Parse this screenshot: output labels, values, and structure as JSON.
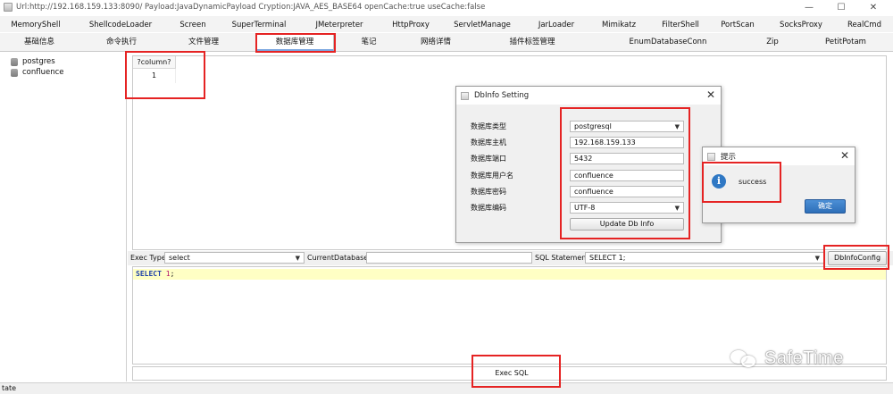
{
  "window": {
    "title": "Url:http://192.168.159.133:8090/ Payload:JavaDynamicPayload Cryption:JAVA_AES_BASE64 openCache:true useCache:false",
    "minimize": "—",
    "maximize": "☐",
    "close": "✕"
  },
  "plugin_tabs": [
    "MemoryShell",
    "ShellcodeLoader",
    "Screen",
    "SuperTerminal",
    "JMeterpreter",
    "HttpProxy",
    "ServletManage",
    "JarLoader",
    "Mimikatz",
    "FilterShell",
    "PortScan",
    "SocksProxy",
    "RealCmd"
  ],
  "main_tabs": [
    "基础信息",
    "命令执行",
    "文件管理",
    "数据库管理",
    "笔记",
    "网络详情",
    "插件标签管理",
    "EnumDatabaseConn",
    "Zip",
    "PetitPotam"
  ],
  "active_main_tab": "数据库管理",
  "tree": {
    "items": [
      "postgres",
      "confluence"
    ]
  },
  "result": {
    "column_header": "?column?",
    "cell_value": "1"
  },
  "db_dialog": {
    "title": "DbInfo Setting",
    "labels": [
      "数据库类型",
      "数据库主机",
      "数据库端口",
      "数据库用户名",
      "数据库密码",
      "数据库编码"
    ],
    "db_type": "postgresql",
    "host": "192.168.159.133",
    "port": "5432",
    "username": "confluence",
    "password": "confluence",
    "encoding": "UTF-8",
    "update_button": "Update Db Info"
  },
  "msg_dialog": {
    "title": "提示",
    "message": "success",
    "ok_button": "确定"
  },
  "toolbar": {
    "exec_type_label": "Exec Type",
    "exec_type_value": "select",
    "current_db_label": "CurrentDatabase",
    "current_db_value": "",
    "sql_label": "SQL Statement",
    "sql_value": "SELECT 1;",
    "dbinfo_button": "DbInfoConfig"
  },
  "editor": {
    "keyword": "SELECT",
    "number": "1",
    "terminator": ";"
  },
  "exec_button": "Exec SQL",
  "status": "tate",
  "watermark": "SafeTime",
  "colors": {
    "highlight_red": "#e52323",
    "editor_line": "#ffffc4",
    "info_blue": "#2f78c4"
  }
}
